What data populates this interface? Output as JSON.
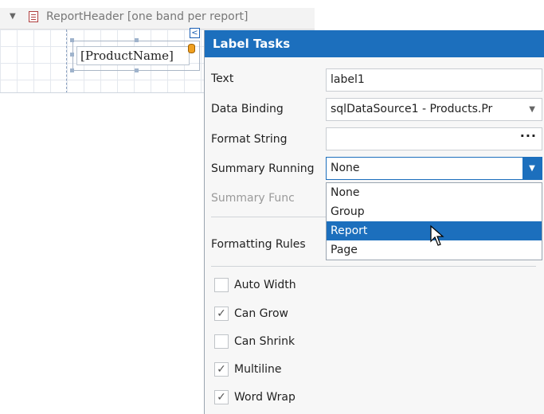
{
  "designer": {
    "band_title": "ReportHeader [one band per report]",
    "label_text": "[ProductName]",
    "smart_tag_glyph": "<",
    "collapse_glyph": "▼"
  },
  "panel": {
    "title": "Label Tasks",
    "rows": {
      "text": {
        "label": "Text",
        "value": "label1"
      },
      "data_binding": {
        "label": "Data Binding",
        "value": "sqlDataSource1 - Products.Pr"
      },
      "format_string": {
        "label": "Format String",
        "value": ""
      },
      "summary_running": {
        "label": "Summary Running",
        "value": "None"
      },
      "summary_func": {
        "label": "Summary Func"
      },
      "formatting_rules": {
        "label": "Formatting Rules"
      }
    },
    "dropdown_options": [
      "None",
      "Group",
      "Report",
      "Page"
    ],
    "dropdown_selected": "Report",
    "checkboxes": [
      {
        "label": "Auto Width",
        "checked": false
      },
      {
        "label": "Can Grow",
        "checked": true
      },
      {
        "label": "Can Shrink",
        "checked": false
      },
      {
        "label": "Multiline",
        "checked": true
      },
      {
        "label": "Word Wrap",
        "checked": true
      }
    ]
  },
  "colors": {
    "accent": "#1c6fbd"
  }
}
